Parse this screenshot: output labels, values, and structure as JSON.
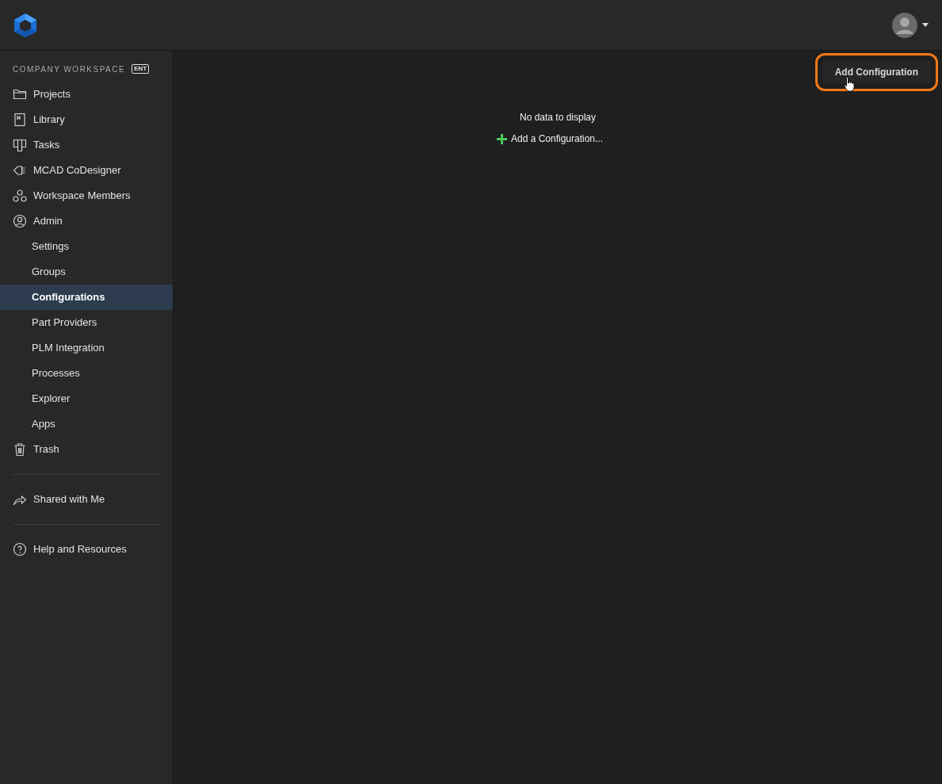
{
  "header": {
    "avatar": true
  },
  "sidebar": {
    "workspace_label": "COMPANY WORKSPACE",
    "plan_badge": "ENT",
    "groups": [
      [
        {
          "label": "Projects",
          "selected": false
        },
        {
          "label": "Library",
          "selected": false
        },
        {
          "label": "Tasks",
          "selected": false
        },
        {
          "label": "MCAD CoDesigner",
          "selected": false
        },
        {
          "label": "Workspace Members",
          "selected": false
        },
        {
          "label": "Admin",
          "selected": false,
          "children": [
            {
              "label": "Settings",
              "selected": false
            },
            {
              "label": "Groups",
              "selected": false
            },
            {
              "label": "Configurations",
              "selected": true
            },
            {
              "label": "Part Providers",
              "selected": false
            },
            {
              "label": "PLM Integration",
              "selected": false
            },
            {
              "label": "Processes",
              "selected": false
            },
            {
              "label": "Explorer",
              "selected": false
            },
            {
              "label": "Apps",
              "selected": false
            }
          ]
        },
        {
          "label": "Trash",
          "selected": false
        }
      ],
      [
        {
          "label": "Shared with Me",
          "selected": false
        }
      ],
      [
        {
          "label": "Help and Resources",
          "selected": false
        }
      ]
    ]
  },
  "main": {
    "add_button": {
      "label": "Add Configuration",
      "highlighted": true
    },
    "empty_message": "No data to display",
    "add_link": "Add a Configuration..."
  }
}
